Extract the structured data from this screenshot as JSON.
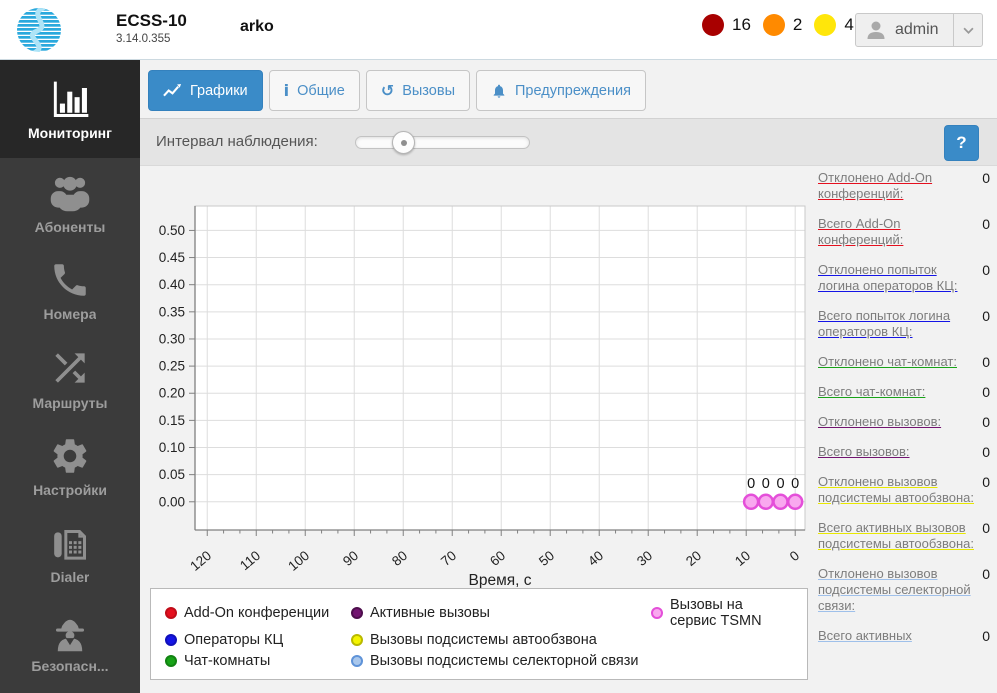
{
  "header": {
    "app_title": "ECSS-10",
    "version": "3.14.0.355",
    "hostname": "arko",
    "alerts": [
      {
        "severity": "critical",
        "color": "#a80000",
        "count": "16"
      },
      {
        "severity": "major",
        "color": "#ff8a00",
        "count": "2"
      },
      {
        "severity": "minor",
        "color": "#ffe60a",
        "count": "4"
      }
    ],
    "user": "admin"
  },
  "theme": {
    "accent": "#3a8bc8"
  },
  "sidebar": {
    "items": [
      {
        "label": "Мониторинг",
        "icon": "bar-chart-icon",
        "active": true
      },
      {
        "label": "Абоненты",
        "icon": "users-icon"
      },
      {
        "label": "Номера",
        "icon": "phone-icon"
      },
      {
        "label": "Маршруты",
        "icon": "shuffle-icon"
      },
      {
        "label": "Настройки",
        "icon": "gear-icon"
      },
      {
        "label": "Dialer",
        "icon": "dialer-icon"
      },
      {
        "label": "Безопасн...",
        "icon": "spy-icon"
      }
    ]
  },
  "tabs": [
    {
      "label": "Графики",
      "icon": "line-chart-icon",
      "active": true
    },
    {
      "label": "Общие",
      "icon": "info-icon"
    },
    {
      "label": "Вызовы",
      "icon": "history-icon"
    },
    {
      "label": "Предупреждения",
      "icon": "bell-icon"
    }
  ],
  "controls": {
    "interval_label": "Интервал наблюдения:",
    "slider_percent": 27,
    "help_label": "?"
  },
  "chart_data": {
    "type": "line",
    "xlabel": "Время, с",
    "ylabel": "",
    "x_ticks": [
      120,
      110,
      100,
      90,
      80,
      70,
      60,
      50,
      40,
      30,
      20,
      10,
      0
    ],
    "y_ticks": [
      "0.00",
      "0.05",
      "0.10",
      "0.15",
      "0.20",
      "0.25",
      "0.30",
      "0.35",
      "0.40",
      "0.45",
      "0.50"
    ],
    "xlim": [
      122.5,
      -2
    ],
    "ylim": [
      -0.052,
      0.545
    ],
    "grid": true,
    "x_axis_reversed": true,
    "series": [
      {
        "name": "Add-On конференции",
        "fill": "#e50f1e",
        "border": "#c00d19",
        "points": []
      },
      {
        "name": "Операторы КЦ",
        "fill": "#1414e6",
        "border": "#1010bb",
        "points": []
      },
      {
        "name": "Чат-комнаты",
        "fill": "#17a317",
        "border": "#128312",
        "points": []
      },
      {
        "name": "Активные вызовы",
        "fill": "#721470",
        "border": "#4e0e4d",
        "points": []
      },
      {
        "name": "Вызовы подсистемы автообзвона",
        "fill": "#f4f400",
        "border": "#b9b900",
        "points": []
      },
      {
        "name": "Вызовы подсистемы селекторной связи",
        "fill": "#a9c7ec",
        "border": "#5f93d8",
        "points": []
      },
      {
        "name": "Вызовы на сервис TSMN",
        "fill": "#f9a8ef",
        "border": "#e44fd9",
        "points": [
          {
            "x": 9,
            "y": 0,
            "label": "0"
          },
          {
            "x": 6,
            "y": 0,
            "label": "0"
          },
          {
            "x": 3,
            "y": 0,
            "label": "0"
          },
          {
            "x": 0,
            "y": 0,
            "label": "0"
          }
        ]
      }
    ]
  },
  "stats": [
    {
      "label": "Отклонено Add-On конференций:",
      "value": "0",
      "color": "#e50f1e"
    },
    {
      "label": "Всего Add-On конференций:",
      "value": "0",
      "color": "#e50f1e"
    },
    {
      "label": "Отклонено попыток логина операторов КЦ:",
      "value": "0",
      "color": "#1414e6"
    },
    {
      "label": "Всего попыток логина операторов КЦ:",
      "value": "0",
      "color": "#1414e6"
    },
    {
      "label": "Отклонено чат-комнат:",
      "value": "0",
      "color": "#17a317"
    },
    {
      "label": "Всего чат-комнат:",
      "value": "0",
      "color": "#17a317"
    },
    {
      "label": "Отклонено вызовов:",
      "value": "0",
      "color": "#721470"
    },
    {
      "label": "Всего вызовов:",
      "value": "0",
      "color": "#721470"
    },
    {
      "label": "Отклонено вызовов подсистемы автообзвона:",
      "value": "0",
      "color": "#e8e800"
    },
    {
      "label": "Всего активных вызовов подсистемы автообзвона:",
      "value": "0",
      "color": "#e8e800"
    },
    {
      "label": "Отклонено вызовов подсистемы селекторной связи:",
      "value": "0",
      "color": "#9fc0ea"
    },
    {
      "label": "Всего активных",
      "value": "0",
      "color": "#9fc0ea"
    }
  ]
}
